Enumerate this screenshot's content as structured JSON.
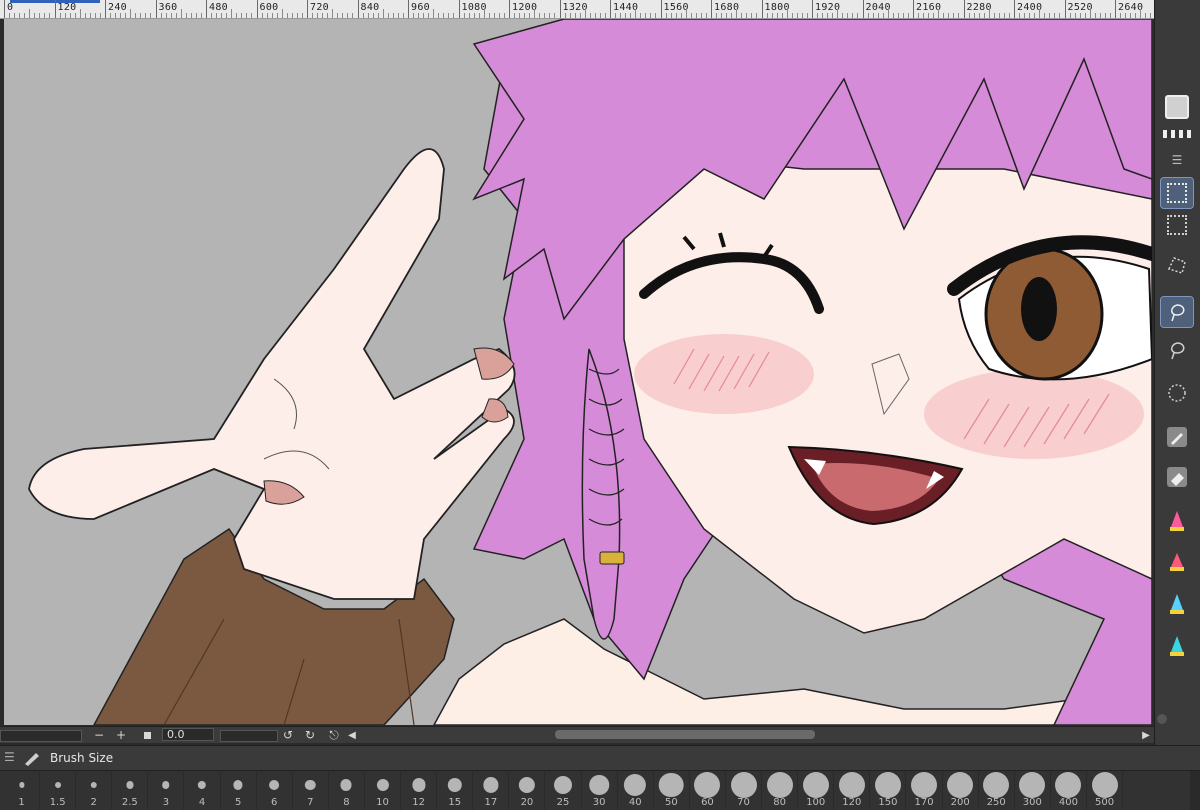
{
  "ruler": {
    "labels": [
      "0",
      "120",
      "240",
      "360",
      "480",
      "600",
      "720",
      "840",
      "960",
      "1080",
      "1200",
      "1320",
      "1440",
      "1560",
      "1680",
      "1800",
      "1920",
      "2040",
      "2160",
      "2280",
      "2400",
      "2520",
      "2640"
    ]
  },
  "toolbar": {
    "tools": [
      {
        "name": "color-swatch-icon"
      },
      {
        "name": "pattern-icon"
      },
      {
        "name": "panel-menu-icon"
      },
      {
        "name": "rect-select-icon"
      },
      {
        "name": "rect-select-alt-icon"
      },
      {
        "name": "polyline-select-icon"
      },
      {
        "name": "lasso-select-icon",
        "active": true
      },
      {
        "name": "lasso-select-alt-icon"
      },
      {
        "name": "ellipse-select-icon"
      },
      {
        "name": "selection-pen-icon"
      },
      {
        "name": "selection-eraser-icon"
      },
      {
        "name": "brush-pink-icon"
      },
      {
        "name": "brush-red-icon"
      },
      {
        "name": "brush-blue-icon"
      },
      {
        "name": "brush-cyan-icon"
      }
    ]
  },
  "canvas_controls": {
    "minus": "−",
    "plus": "+",
    "zoom_value": "0.0"
  },
  "brush_panel": {
    "title": "Brush Size",
    "sizes": [
      "1",
      "1.5",
      "2",
      "2.5",
      "3",
      "4",
      "5",
      "6",
      "7",
      "8",
      "10",
      "12",
      "15",
      "17",
      "20",
      "25",
      "30",
      "40",
      "50",
      "60",
      "70",
      "80",
      "100",
      "120",
      "150",
      "170",
      "200",
      "250",
      "300",
      "400",
      "500"
    ]
  },
  "colors": {
    "background": "#b4b4b4",
    "hair": "#d58bd8",
    "skin": "#fdeee9",
    "eye": "#8f5b35",
    "sleeve": "#7b5940",
    "accent": "#2f63b8"
  }
}
